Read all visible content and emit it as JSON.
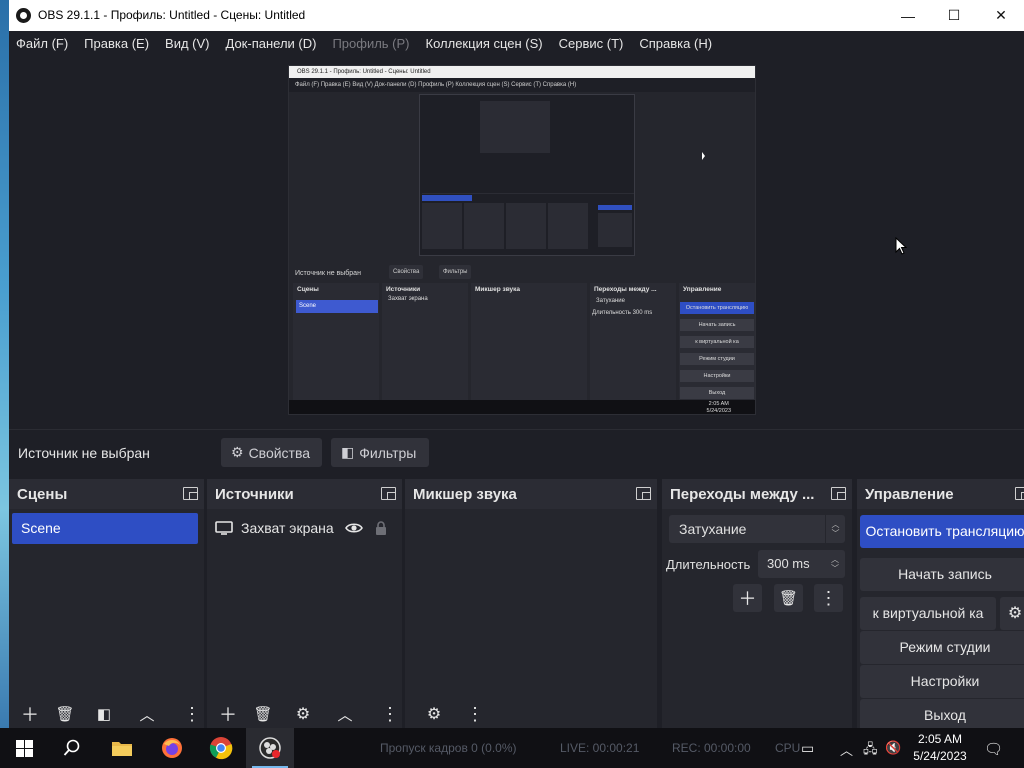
{
  "window": {
    "title": "OBS 29.1.1 - Профиль: Untitled - Сцены: Untitled",
    "minimize": "—",
    "maximize": "☐",
    "close": "✕"
  },
  "menu": {
    "items": [
      {
        "label": "Файл (F)",
        "enabled": true
      },
      {
        "label": "Правка (E)",
        "enabled": true
      },
      {
        "label": "Вид (V)",
        "enabled": true
      },
      {
        "label": "Док-панели (D)",
        "enabled": true
      },
      {
        "label": "Профиль (P)",
        "enabled": false
      },
      {
        "label": "Коллекция сцен (S)",
        "enabled": true
      },
      {
        "label": "Сервис (T)",
        "enabled": true
      },
      {
        "label": "Справка (H)",
        "enabled": true
      }
    ]
  },
  "preview": {
    "mini_title": "OBS 29.1.1 - Профиль: Untitled - Сцены: Untitled",
    "mini_menu": "Файл (F)  Правка (E)  Вид (V)  Док-панели (D)  Профиль (P)  Коллекция сцен (S)  Сервис (T)  Справка (H)",
    "mini_source_label": "Источник не выбран",
    "mini_props": "Свойства",
    "mini_filters": "Фильтры",
    "mini_docks": [
      "Сцены",
      "Источники",
      "Микшер звука",
      "Переходы между ...",
      "Управление"
    ],
    "mini_scene": "Scene",
    "mini_source": "Захват экрана",
    "mini_fade": "Затухание",
    "mini_duration": "Длительность",
    "mini_ms": "300 ms",
    "mini_controls": [
      "Остановить трансляцию",
      "Начать запись",
      "к виртуальной ка",
      "Режим студии",
      "Настройки",
      "Выход"
    ],
    "mini_time": "2:05 AM",
    "mini_date": "5/24/2023"
  },
  "source_bar": {
    "label": "Источник не выбран",
    "properties": "Свойства",
    "filters": "Фильтры"
  },
  "docks": {
    "scenes": {
      "title": "Сцены",
      "items": [
        "Scene"
      ]
    },
    "sources": {
      "title": "Источники",
      "items": [
        {
          "label": "Захват экрана",
          "visible": true,
          "locked": false
        }
      ]
    },
    "mixer": {
      "title": "Микшер звука"
    },
    "transitions": {
      "title": "Переходы между ...",
      "type": "Затухание",
      "duration_label": "Длительность",
      "duration_value": "300 ms"
    },
    "controls": {
      "title": "Управление",
      "stop_stream": "Остановить трансляцию",
      "start_record": "Начать запись",
      "virtual_cam": "к виртуальной ка",
      "studio_mode": "Режим студии",
      "settings": "Настройки",
      "exit": "Выход"
    }
  },
  "taskbar": {
    "status_dropped": "Пропуск кадров 0 (0.0%)",
    "status_live": "LIVE: 00:00:21",
    "status_rec": "REC: 00:00:00",
    "status_cpu": "CPU",
    "time": "2:05 AM",
    "date": "5/24/2023"
  },
  "colors": {
    "accent": "#2e4ec4",
    "background": "#1e1f26",
    "dock": "#25262d",
    "button": "#31323a"
  }
}
